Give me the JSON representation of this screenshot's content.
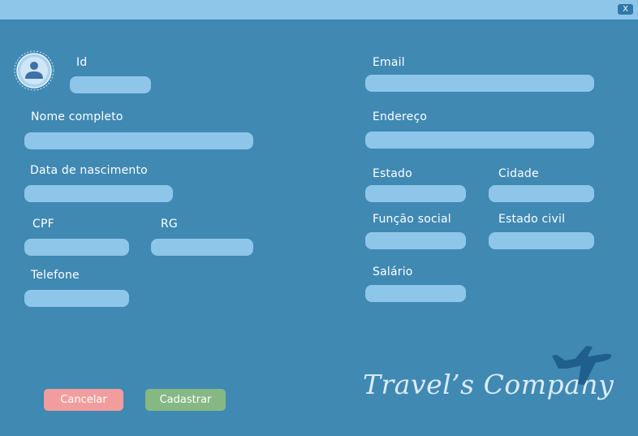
{
  "window": {
    "close_label": "X"
  },
  "form": {
    "id": {
      "label": "Id",
      "value": ""
    },
    "nome": {
      "label": "Nome completo",
      "value": ""
    },
    "nascimento": {
      "label": "Data de nascimento",
      "value": ""
    },
    "cpf": {
      "label": "CPF",
      "value": ""
    },
    "rg": {
      "label": "RG",
      "value": ""
    },
    "telefone": {
      "label": "Telefone",
      "value": ""
    },
    "email": {
      "label": "Email",
      "value": ""
    },
    "endereco": {
      "label": "Endereço",
      "value": ""
    },
    "estado": {
      "label": "Estado",
      "value": ""
    },
    "cidade": {
      "label": "Cidade",
      "value": ""
    },
    "funcao": {
      "label": "Função social",
      "value": ""
    },
    "estado_civil": {
      "label": "Estado civil",
      "value": ""
    },
    "salario": {
      "label": "Salário",
      "value": ""
    }
  },
  "actions": {
    "cancel_label": "Cancelar",
    "submit_label": "Cadastrar"
  },
  "brand": {
    "name": "Travel’s Company"
  },
  "colors": {
    "background": "#3f89b3",
    "field": "#8ec6ea",
    "cancel": "#f29d9d",
    "submit": "#86b884",
    "plane": "#1e5f8d"
  },
  "icons": {
    "avatar": "user-avatar-icon",
    "close": "close-icon",
    "logo": "airplane-icon"
  }
}
